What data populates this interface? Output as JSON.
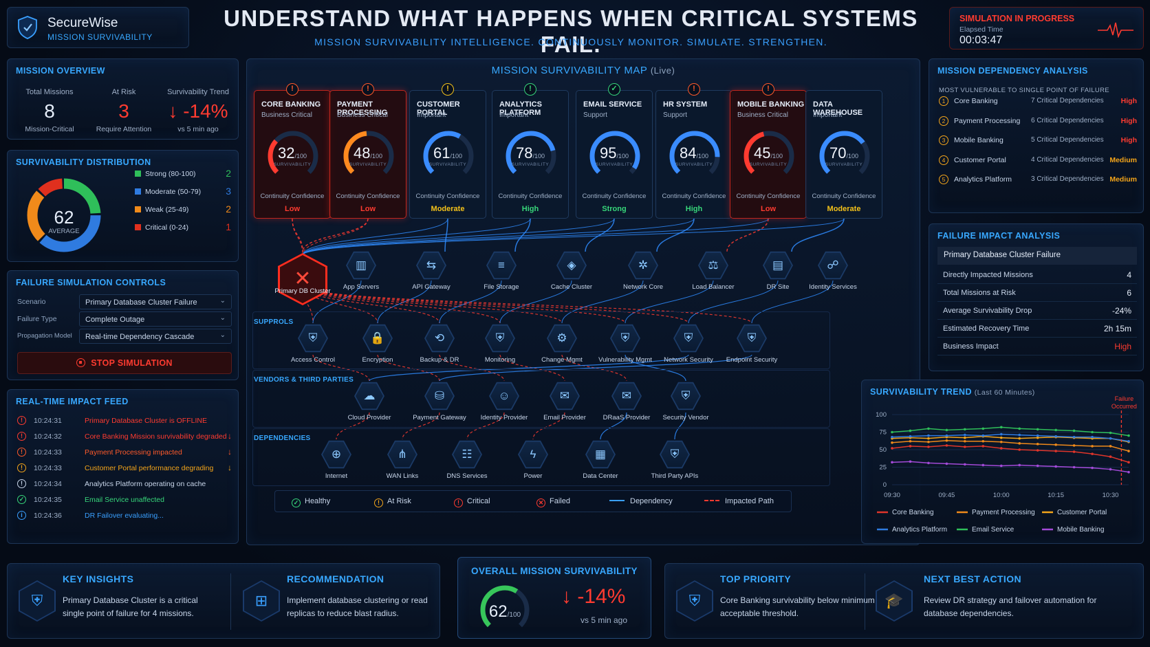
{
  "brand": {
    "name": "SecureWise",
    "tagline": "MISSION SURVIVABILITY"
  },
  "headline": "UNDERSTAND WHAT HAPPENS WHEN CRITICAL SYSTEMS FAIL.",
  "subheadline": "MISSION SURVIVABILITY INTELLIGENCE. CONTINUOUSLY MONITOR. SIMULATE. STRENGTHEN.",
  "simulation": {
    "status": "SIMULATION IN PROGRESS",
    "elapsed_label": "Elapsed Time",
    "elapsed": "00:03:47"
  },
  "overview": {
    "title": "MISSION OVERVIEW",
    "total": {
      "label": "Total Missions",
      "value": "8",
      "sub": "Mission-Critical"
    },
    "risk": {
      "label": "At Risk",
      "value": "3",
      "sub": "Require Attention"
    },
    "trend": {
      "label": "Survivability Trend",
      "value": "-14%",
      "sub": "vs 5 min ago"
    }
  },
  "distribution": {
    "title": "SURVIVABILITY DISTRIBUTION",
    "average": "62",
    "average_label": "AVERAGE",
    "rows": [
      {
        "label": "Strong (80-100)",
        "count": "2",
        "color": "#2fbf5a"
      },
      {
        "label": "Moderate (50-79)",
        "count": "3",
        "color": "#2f7be0"
      },
      {
        "label": "Weak (25-49)",
        "count": "2",
        "color": "#f08a1a"
      },
      {
        "label": "Critical (0-24)",
        "count": "1",
        "color": "#e0301e"
      }
    ]
  },
  "controls": {
    "title": "FAILURE SIMULATION CONTROLS",
    "scenario": {
      "label": "Scenario",
      "value": "Primary Database Cluster Failure"
    },
    "failure_type": {
      "label": "Failure Type",
      "value": "Complete Outage"
    },
    "propagation": {
      "label": "Propagation Model",
      "value": "Real-time Dependency Cascade"
    },
    "stop_label": "STOP SIMULATION"
  },
  "feed": {
    "title": "REAL-TIME IMPACT FEED",
    "items": [
      {
        "time": "10:24:31",
        "text": "Primary Database Cluster is OFFLINE",
        "icon": "!",
        "color": "#ff3b30",
        "arrow": ""
      },
      {
        "time": "10:24:32",
        "text": "Core Banking Mission survivability degraded",
        "icon": "!",
        "color": "#ff3b30",
        "arrow": "↓"
      },
      {
        "time": "10:24:33",
        "text": "Payment Processing impacted",
        "icon": "!",
        "color": "#ff5a2a",
        "arrow": "↓"
      },
      {
        "time": "10:24:33",
        "text": "Customer Portal performance degrading",
        "icon": "!",
        "color": "#f4a51a",
        "arrow": "↓"
      },
      {
        "time": "10:24:34",
        "text": "Analytics Platform operating on cache",
        "icon": "!",
        "color": "#c8d6ea",
        "arrow": ""
      },
      {
        "time": "10:24:35",
        "text": "Email Service unaffected",
        "icon": "✓",
        "color": "#37d67a",
        "arrow": ""
      },
      {
        "time": "10:24:36",
        "text": "DR Failover evaluating...",
        "icon": "i",
        "color": "#3aa0ff",
        "arrow": ""
      }
    ]
  },
  "map": {
    "title": "MISSION SURVIVABILITY MAP",
    "live": "(Live)",
    "missions": [
      {
        "name": "CORE BANKING",
        "cat": "Business Critical",
        "score": 32,
        "conf": "Low",
        "color": "#ff3b30",
        "crit": true,
        "warn": "!",
        "warn_color": "#ff5a2a"
      },
      {
        "name": "PAYMENT PROCESSING",
        "cat": "Business Critical",
        "score": 48,
        "conf": "Low",
        "color": "#ff8a1f",
        "crit": true,
        "warn": "!",
        "warn_color": "#ff5a2a"
      },
      {
        "name": "CUSTOMER PORTAL",
        "cat": "Important",
        "score": 61,
        "conf": "Moderate",
        "color": "#3a8cff",
        "crit": false,
        "warn": "!",
        "warn_color": "#f4c21a"
      },
      {
        "name": "ANALYTICS PLATFORM",
        "cat": "Important",
        "score": 78,
        "conf": "High",
        "color": "#3a8cff",
        "crit": false,
        "warn": "!",
        "warn_color": "#37d67a"
      },
      {
        "name": "EMAIL SERVICE",
        "cat": "Support",
        "score": 95,
        "conf": "Strong",
        "color": "#3a8cff",
        "crit": false,
        "warn": "✓",
        "warn_color": "#37d67a"
      },
      {
        "name": "HR SYSTEM",
        "cat": "Support",
        "score": 84,
        "conf": "High",
        "color": "#3a8cff",
        "crit": false,
        "warn": "!",
        "warn_color": "#ff5a2a"
      },
      {
        "name": "MOBILE BANKING",
        "cat": "Business Critical",
        "score": 45,
        "conf": "Low",
        "color": "#ff3b30",
        "crit": true,
        "warn": "!",
        "warn_color": "#ff5a2a"
      },
      {
        "name": "DATA WAREHOUSE",
        "cat": "Important",
        "score": 70,
        "conf": "Moderate",
        "color": "#3a8cff",
        "crit": false,
        "warn": "",
        "warn_color": ""
      }
    ],
    "score_suffix": "/100",
    "score_label": "SURVIVABILITY",
    "conf_label": "Continuity Confidence",
    "conf_colors": {
      "Low": "#ff3b30",
      "Moderate": "#f4c21a",
      "High": "#37d67a",
      "Strong": "#37d67a"
    },
    "primary_node": "Primary DB Cluster",
    "infra": [
      {
        "name": "App Servers",
        "icon": "▥"
      },
      {
        "name": "API Gateway",
        "icon": "⇆"
      },
      {
        "name": "File Storage",
        "icon": "≡"
      },
      {
        "name": "Cache Cluster",
        "icon": "◈"
      },
      {
        "name": "Network Core",
        "icon": "✲"
      },
      {
        "name": "Load Balancer",
        "icon": "⚖"
      },
      {
        "name": "DR Site",
        "icon": "▤"
      },
      {
        "name": "Identity Services",
        "icon": "☍"
      }
    ],
    "support_title": "SUPPROLS",
    "support": [
      {
        "name": "Access Control",
        "icon": "⛨"
      },
      {
        "name": "Encryption",
        "icon": "🔒"
      },
      {
        "name": "Backup & DR",
        "icon": "⟲"
      },
      {
        "name": "Monitoring",
        "icon": "⛨"
      },
      {
        "name": "Change Mgmt",
        "icon": "⚙"
      },
      {
        "name": "Vulnerability Mgmt",
        "icon": "⛨"
      },
      {
        "name": "Network Security",
        "icon": "⛨"
      },
      {
        "name": "Endpoint Security",
        "icon": "⛨"
      }
    ],
    "vendors_title": "VENDORS & THIRD PARTIES",
    "vendors": [
      {
        "name": "Cloud Provider",
        "icon": "☁"
      },
      {
        "name": "Payment Gateway",
        "icon": "⛁"
      },
      {
        "name": "Identity Provider",
        "icon": "☺"
      },
      {
        "name": "Email Provider",
        "icon": "✉"
      },
      {
        "name": "DRaaS Provider",
        "icon": "✉"
      },
      {
        "name": "Security Vendor",
        "icon": "⛨"
      }
    ],
    "deps_title": "DEPENDENCIES",
    "deps": [
      {
        "name": "Internet",
        "icon": "⊕"
      },
      {
        "name": "WAN Links",
        "icon": "⋔"
      },
      {
        "name": "DNS Services",
        "icon": "☷"
      },
      {
        "name": "Power",
        "icon": "ϟ"
      },
      {
        "name": "Data Center",
        "icon": "▦"
      },
      {
        "name": "Third Party APIs",
        "icon": "⛨"
      }
    ],
    "legend": {
      "healthy": "Healthy",
      "at_risk": "At Risk",
      "critical": "Critical",
      "failed": "Failed",
      "dependency": "Dependency",
      "impacted": "Impacted Path"
    }
  },
  "dependency": {
    "title": "MISSION DEPENDENCY ANALYSIS",
    "subtitle": "MOST VULNERABLE TO SINGLE POINT OF FAILURE",
    "rows": [
      {
        "n": "1",
        "name": "Core Banking",
        "deps": "7 Critical Dependencies",
        "risk": "High",
        "color": "#ff3b30"
      },
      {
        "n": "2",
        "name": "Payment Processing",
        "deps": "6 Critical Dependencies",
        "risk": "High",
        "color": "#ff3b30"
      },
      {
        "n": "3",
        "name": "Mobile Banking",
        "deps": "5 Critical Dependencies",
        "risk": "High",
        "color": "#ff3b30"
      },
      {
        "n": "4",
        "name": "Customer Portal",
        "deps": "4 Critical Dependencies",
        "risk": "Medium",
        "color": "#f4a51a"
      },
      {
        "n": "5",
        "name": "Analytics Platform",
        "deps": "3 Critical Dependencies",
        "risk": "Medium",
        "color": "#f4a51a"
      }
    ]
  },
  "impact": {
    "title": "FAILURE IMPACT ANALYSIS",
    "scenario": "Primary Database Cluster Failure",
    "rows": [
      {
        "k": "Directly Impacted Missions",
        "v": "4"
      },
      {
        "k": "Total Missions at Risk",
        "v": "6"
      },
      {
        "k": "Average Survivability Drop",
        "v": "-24%"
      },
      {
        "k": "Estimated Recovery Time",
        "v": "2h 15m"
      },
      {
        "k": "Business Impact",
        "v": "High",
        "color": "#ff3b30"
      }
    ]
  },
  "chart_data": {
    "type": "line",
    "title": "SURVIVABILITY TREND",
    "subtitle": "(Last 60 Minutes)",
    "x": [
      "09:30",
      "09:35",
      "09:40",
      "09:45",
      "09:50",
      "09:55",
      "10:00",
      "10:05",
      "10:10",
      "10:15",
      "10:20",
      "10:25",
      "10:30",
      "10:35"
    ],
    "xticks": [
      "09:30",
      "09:45",
      "10:00",
      "10:15",
      "10:30"
    ],
    "ylim": [
      0,
      100
    ],
    "yticks": [
      0,
      25,
      50,
      75,
      100
    ],
    "annotation": {
      "label": "Failure Occurred",
      "x": "10:33"
    },
    "series": [
      {
        "name": "Core Banking",
        "color": "#e0352a",
        "values": [
          52,
          55,
          54,
          56,
          54,
          55,
          52,
          50,
          49,
          48,
          47,
          44,
          40,
          32
        ]
      },
      {
        "name": "Payment Processing",
        "color": "#f08a1a",
        "values": [
          60,
          62,
          61,
          63,
          62,
          62,
          61,
          59,
          58,
          57,
          56,
          55,
          55,
          48
        ]
      },
      {
        "name": "Customer Portal",
        "color": "#f4a51a",
        "values": [
          66,
          67,
          66,
          68,
          67,
          69,
          67,
          66,
          67,
          68,
          67,
          66,
          66,
          61
        ]
      },
      {
        "name": "Analytics Platform",
        "color": "#2f7be0",
        "values": [
          68,
          69,
          70,
          70,
          71,
          70,
          72,
          71,
          70,
          69,
          68,
          68,
          66,
          62
        ]
      },
      {
        "name": "Email Service",
        "color": "#2fbf5a",
        "values": [
          75,
          77,
          80,
          78,
          79,
          80,
          82,
          80,
          79,
          78,
          77,
          75,
          74,
          70
        ]
      },
      {
        "name": "Mobile Banking",
        "color": "#a34ad8",
        "values": [
          32,
          33,
          31,
          30,
          29,
          28,
          27,
          28,
          27,
          26,
          25,
          24,
          22,
          18
        ]
      }
    ]
  },
  "overall": {
    "title": "OVERALL MISSION SURVIVABILITY",
    "score": "62",
    "suffix": "/100",
    "delta": "-14%",
    "sub": "vs 5 min ago"
  },
  "bottom": {
    "insights": {
      "title": "KEY INSIGHTS",
      "text": "Primary Database Cluster is a critical single point of failure for 4 missions."
    },
    "recommendation": {
      "title": "RECOMMENDATION",
      "text": "Implement database clustering or read replicas to reduce blast radius."
    },
    "priority": {
      "title": "TOP PRIORITY",
      "text": "Core Banking survivability below minimum acceptable threshold."
    },
    "next": {
      "title": "NEXT BEST ACTION",
      "text": "Review DR strategy and failover automation for database dependencies."
    }
  }
}
